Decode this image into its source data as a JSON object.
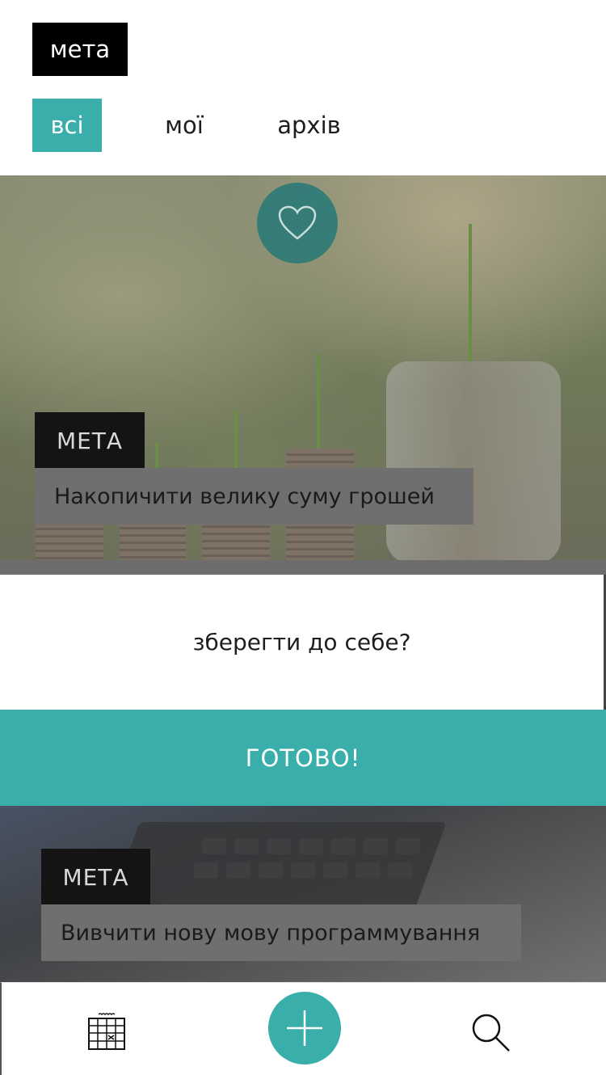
{
  "header": {
    "logo": "мета"
  },
  "tabs": [
    {
      "label": "всі",
      "active": true
    },
    {
      "label": "мої",
      "active": false
    },
    {
      "label": "архів",
      "active": false
    }
  ],
  "cards": [
    {
      "tag": "МЕТА",
      "title": "Накопичити велику суму грошей",
      "favorite_icon": "heart-icon"
    },
    {
      "tag": "МЕТА",
      "title": "Вивчити нову мову программування"
    }
  ],
  "dialog": {
    "question": "зберегти до себе?",
    "confirm_label": "ГОТОВО!"
  },
  "bottom_nav": {
    "left_icon": "calendar-icon",
    "center_icon": "plus-icon",
    "right_icon": "search-icon"
  },
  "colors": {
    "accent": "#3aaeaa",
    "dark": "#000000",
    "tag_bg": "#141414",
    "title_bg": "#6f6f6f"
  }
}
